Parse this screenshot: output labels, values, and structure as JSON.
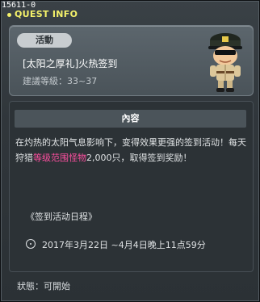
{
  "window": {
    "quest_id": "15611-0",
    "title": "QUEST INFO"
  },
  "header": {
    "badge": "活動",
    "quest_name": "[太阳之厚礼]火热签到",
    "level_label": "建議等級：33~37"
  },
  "content": {
    "section_title": "內容",
    "description_before": "在灼热的太阳气息影响下，变得效果更强的签到活动！每天狩猎",
    "description_highlight": "等级范围怪物",
    "description_after": "2,000只，取得签到奖励！",
    "schedule_title": "《签到活动日程》",
    "date_range": "2017年3月22日 ~4月4日晚上11点59分"
  },
  "footer": {
    "status": "狀態：可開始"
  },
  "colors": {
    "title": "#f4f16a",
    "highlight": "#ff4fa0",
    "background": "#30363b"
  },
  "icons": {
    "npc": "military-officer-npc",
    "date": "clock-icon"
  }
}
